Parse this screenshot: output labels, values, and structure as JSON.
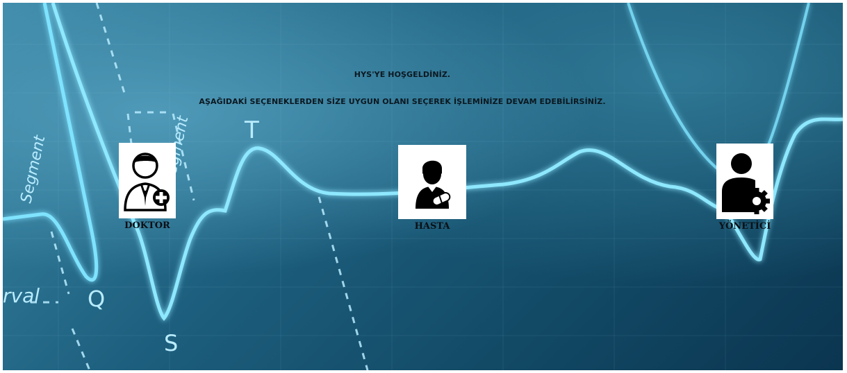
{
  "welcome": {
    "title": "HYS'YE HOŞGELDİNİZ.",
    "subtitle": "AŞAĞIDAKİ SEÇENEKLERDEN SİZE UYGUN OLANI SEÇEREK İŞLEMİNİZE DEVAM EDEBİLİRSİNİZ."
  },
  "options": {
    "doktor": {
      "label": "DOKTOR",
      "icon": "doctor-icon"
    },
    "hasta": {
      "label": "HASTA",
      "icon": "patient-icon"
    },
    "yonetici": {
      "label": "YÖNETİCİ",
      "icon": "admin-gear-icon"
    }
  },
  "background": {
    "wave_labels": [
      "Segment",
      "Segment",
      "T",
      "Q",
      "S",
      "rval"
    ],
    "colors": {
      "glow": "#8ee8ff",
      "dark": "#0b3550",
      "mid": "#1d5f7e"
    }
  }
}
